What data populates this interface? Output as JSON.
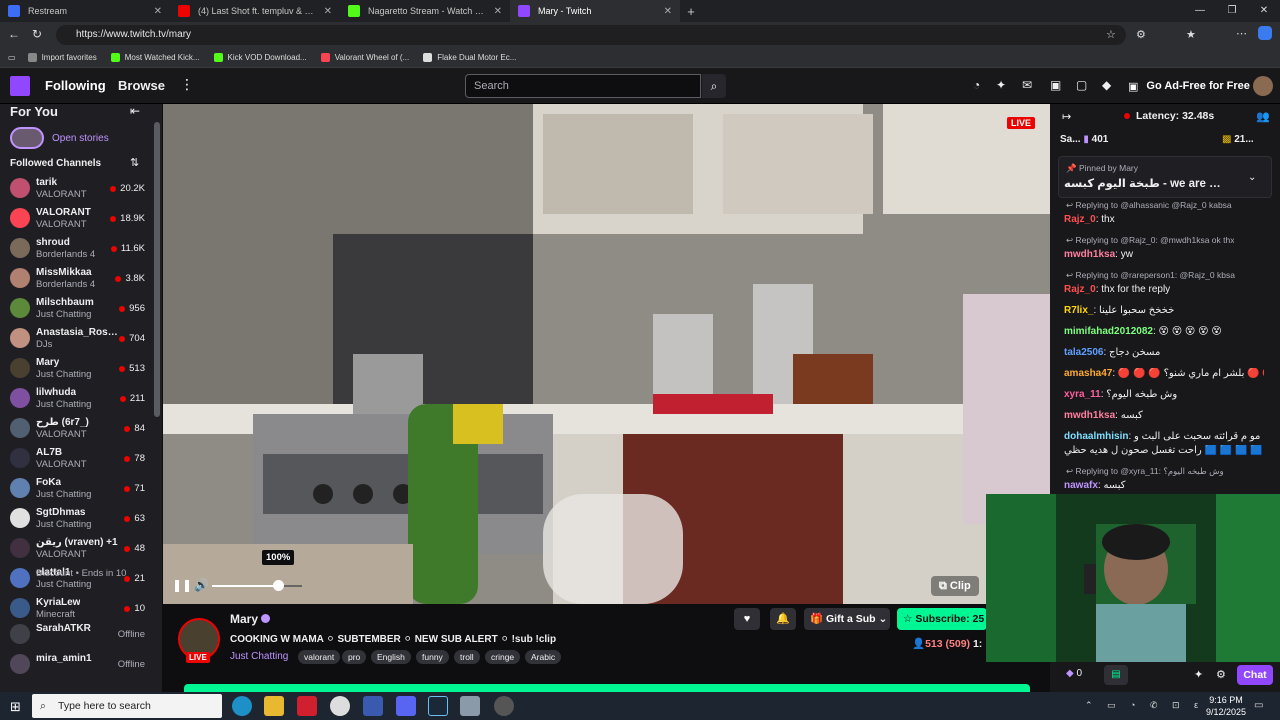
{
  "browser": {
    "tabs": [
      {
        "title": "Restream",
        "color": "#3d6cf5"
      },
      {
        "title": "(4) Last Shot ft. templuv & 347aid",
        "color": "#eb0400"
      },
      {
        "title": "Nagaretto Stream - Watch Live on",
        "color": "#53fc18"
      },
      {
        "title": "Mary - Twitch",
        "color": "#9147ff"
      }
    ],
    "new_tab": "+",
    "url": "https://www.twitch.tv/mary",
    "bookmarks": [
      {
        "label": "Import favorites"
      },
      {
        "label": "Most Watched Kick..."
      },
      {
        "label": "Kick VOD Download..."
      },
      {
        "label": "Valorant Wheel of (..."
      },
      {
        "label": "Flake Dual Motor Ec..."
      }
    ]
  },
  "nav": {
    "following": "Following",
    "browse": "Browse",
    "search_placeholder": "Search",
    "ad_free": "Go Ad-Free for Free"
  },
  "sidebar": {
    "for_you": "For You",
    "open_stories": "Open stories",
    "followed_channels": "Followed Channels",
    "channels": [
      {
        "name": "tarik",
        "game": "VALORANT",
        "viewers": "20.2K",
        "color": "#c05070"
      },
      {
        "name": "VALORANT",
        "game": "VALORANT",
        "viewers": "18.9K",
        "color": "#fa4454"
      },
      {
        "name": "shroud",
        "game": "Borderlands 4",
        "viewers": "11.6K",
        "color": "#7a6a5a"
      },
      {
        "name": "MissMikkaa",
        "game": "Borderlands 4",
        "viewers": "3.8K",
        "color": "#b08070"
      },
      {
        "name": "Milschbaum",
        "game": "Just Chatting",
        "viewers": "956",
        "color": "#5a8a3a"
      },
      {
        "name": "Anastasia_Rose...",
        "game": "DJs",
        "viewers": "704",
        "color": "#c09080"
      },
      {
        "name": "Mary",
        "game": "Just Chatting",
        "viewers": "513",
        "color": "#4a4030"
      },
      {
        "name": "lilwhuda",
        "game": "Just Chatting",
        "viewers": "211",
        "color": "#8050a0"
      },
      {
        "name": "طرح (6r7_)",
        "game": "VALORANT",
        "viewers": "84",
        "color": "#506070"
      },
      {
        "name": "AL7B",
        "game": "VALORANT",
        "viewers": "78",
        "color": "#303040"
      },
      {
        "name": "FoKa",
        "game": "Just Chatting",
        "viewers": "71",
        "color": "#6080b0"
      },
      {
        "name": "SgtDhmas",
        "game": "Just Chatting",
        "viewers": "63",
        "color": "#e0e0e0"
      },
      {
        "name": "ريقن (vraven) +1",
        "game": "VALORANT",
        "viewers": "48",
        "color": "#403040"
      },
      {
        "name": "elattal1",
        "game": "Just Chatting",
        "viewers": "21",
        "color": "#5070c0"
      },
      {
        "name": "KyriaLew",
        "game": "Minecraft",
        "viewers": "10",
        "color": "#3a5a8a"
      },
      {
        "name": "SarahATKR",
        "game": "",
        "viewers": "Offline",
        "color": "#404048"
      },
      {
        "name": "mira_amin1",
        "game": "",
        "viewers": "Offline",
        "color": "#504858"
      }
    ],
    "discount": "Discount • Ends in 10"
  },
  "player": {
    "live": "LIVE",
    "volume": "100%",
    "volume_level": 1.0,
    "clip": "Clip"
  },
  "stream": {
    "name": "Mary",
    "live": "LIVE",
    "title": "COOKING W MAMA ⚪ SUBTEMBER ⚪ NEW SUB ALERT ⚪ !sub !clip",
    "category": "Just Chatting",
    "tags": [
      "valorant",
      "pro",
      "English",
      "funny",
      "troll",
      "cringe",
      "Arabic"
    ],
    "gift": "Gift a Sub",
    "subscribe": "Subscribe: 25",
    "viewers": "513 (509)",
    "uptime": "1:"
  },
  "chat": {
    "latency": "Latency: 32.48s",
    "sa": "Sa...",
    "sa_count": "401",
    "right_count": "21...",
    "pinned_by": "Pinned by Mary",
    "pinned_text": "طبخة اليوم كبسه - we are c...",
    "messages": [
      {
        "type": "reply",
        "text": "Replying to @alhassanic @Rajz_0 kabsa"
      },
      {
        "type": "msg",
        "name": "Rajz_0",
        "color": "#ff4f4f",
        "text": ": thx"
      },
      {
        "type": "reply",
        "text": "Replying to @Rajz_0: @mwdh1ksa ok thx"
      },
      {
        "type": "msg",
        "name": "mwdh1ksa",
        "color": "#ff7f9f",
        "text": ": yw"
      },
      {
        "type": "reply",
        "text": "Replying to @rareperson1: @Rajz_0 kbsa"
      },
      {
        "type": "msg",
        "name": "Rajz_0",
        "color": "#ff4f4f",
        "text": ": thx for the reply"
      },
      {
        "type": "msg",
        "name": "R7lix_",
        "color": "#ffd700",
        "text": ": خخخخ سحبوا علينا"
      },
      {
        "type": "msg",
        "name": "mimifahad2012082",
        "color": "#7fff7f",
        "text": ": 😵 😵 😵 😵 😵"
      },
      {
        "type": "msg",
        "name": "tala2506",
        "color": "#5fa0ff",
        "text": ": مسخن دجاج"
      },
      {
        "type": "msg",
        "name": "amasha47",
        "color": "#ffaa33",
        "text": ": 🔴 🔴 🔴 بلشر ام ماري شنو؟ 🔴 🔴 🔴"
      },
      {
        "type": "msg",
        "name": "xyra_11",
        "color": "#ff5f9f",
        "text": ": وش طبخه اليوم؟"
      },
      {
        "type": "msg",
        "name": "mwdh1ksa",
        "color": "#ff7f9f",
        "text": ": كبسه"
      },
      {
        "type": "msg",
        "name": "dohaalmhisin",
        "color": "#7fdfff",
        "text": ": مو م قرائته سحبت على البث و"
      },
      {
        "type": "msg",
        "name": "",
        "color": "#efeff1",
        "text": "راحت تغسل صحون ل هديه حظي 🟦 🟦 🟦 🟦 🟦"
      },
      {
        "type": "reply",
        "text": "Replying to @xyra_11: وش طبخه اليوم؟"
      },
      {
        "type": "msg",
        "name": "nawafx",
        "color": "#bf94ff",
        "text": ": كبسه"
      }
    ],
    "points": "0",
    "chat_button": "Chat"
  },
  "taskbar": {
    "search": "Type here to search",
    "time": "9:16 PM",
    "date": "9/12/2025"
  }
}
